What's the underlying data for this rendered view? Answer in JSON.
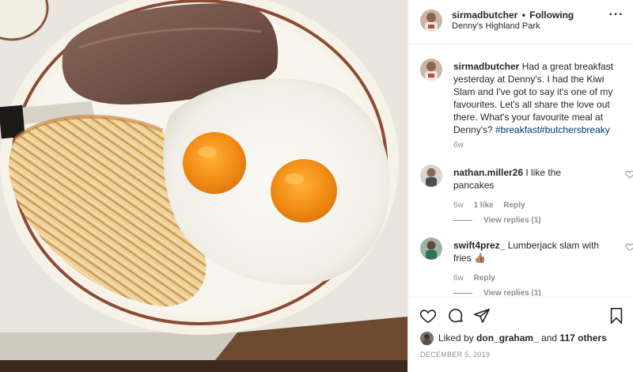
{
  "post": {
    "author": "sirmadbutcher",
    "separator": "•",
    "follow_status": "Following",
    "location": "Denny's Highland Park",
    "more_icon": "ellipsis-icon",
    "more_label": "···"
  },
  "caption": {
    "username": "sirmadbutcher",
    "text": "Had a great breakfast yesterday at Denny's. I had the Kiwi Slam and I've got to say it's one of my favourites. Let's all share the love out there. What's your favourite meal at Denny's?",
    "hashtags": [
      "#breakfast",
      "#butchersbreaky"
    ],
    "time": "6w"
  },
  "comments": [
    {
      "username": "nathan.miller26",
      "text": "I like the pancakes",
      "time": "6w",
      "likes": "1 like",
      "reply": "Reply",
      "view_replies": "View replies (1)"
    },
    {
      "username": "swift4prez_",
      "text": "Lumberjack slam with fries 👍🏽",
      "time": "6w",
      "reply": "Reply",
      "view_replies": "View replies (1)"
    }
  ],
  "actions": {
    "icons": [
      "heart-icon",
      "comment-icon",
      "share-icon",
      "bookmark-icon"
    ]
  },
  "likes": {
    "prefix": "Liked by",
    "user": "don_graham_",
    "joiner": "and",
    "others": "117 others"
  },
  "date": "December 5, 2019",
  "colors": {
    "text": "#262626",
    "secondary": "#8e8e8e",
    "hashtag": "#00376b",
    "divider": "#efefef"
  }
}
